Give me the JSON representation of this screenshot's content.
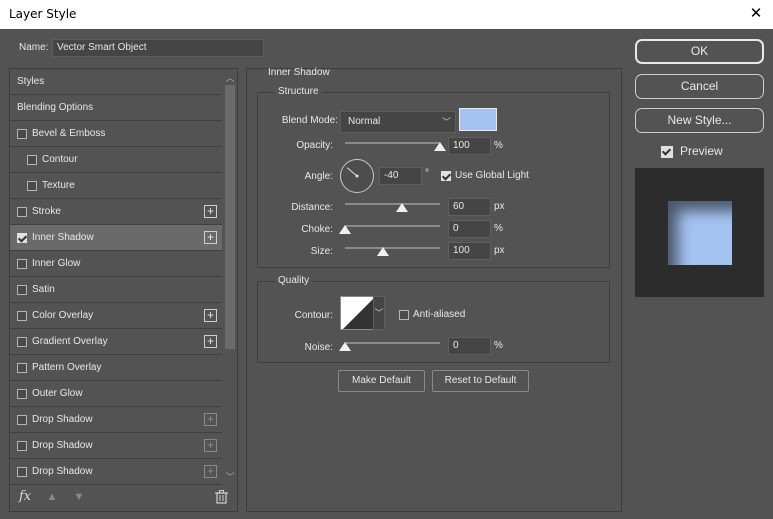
{
  "window": {
    "title": "Layer Style",
    "close_glyph": "✕"
  },
  "name": {
    "label": "Name:",
    "value": "Vector Smart Object"
  },
  "styles_list": [
    {
      "label": "Styles",
      "checkbox": false,
      "checked": false,
      "indent": false,
      "plus": "none",
      "active": false
    },
    {
      "label": "Blending Options",
      "checkbox": false,
      "checked": false,
      "indent": false,
      "plus": "none",
      "active": false
    },
    {
      "label": "Bevel & Emboss",
      "checkbox": true,
      "checked": false,
      "indent": false,
      "plus": "none",
      "active": false
    },
    {
      "label": "Contour",
      "checkbox": true,
      "checked": false,
      "indent": true,
      "plus": "none",
      "active": false
    },
    {
      "label": "Texture",
      "checkbox": true,
      "checked": false,
      "indent": true,
      "plus": "none",
      "active": false
    },
    {
      "label": "Stroke",
      "checkbox": true,
      "checked": false,
      "indent": false,
      "plus": "bright",
      "active": false
    },
    {
      "label": "Inner Shadow",
      "checkbox": true,
      "checked": true,
      "indent": false,
      "plus": "bright",
      "active": true
    },
    {
      "label": "Inner Glow",
      "checkbox": true,
      "checked": false,
      "indent": false,
      "plus": "none",
      "active": false
    },
    {
      "label": "Satin",
      "checkbox": true,
      "checked": false,
      "indent": false,
      "plus": "none",
      "active": false
    },
    {
      "label": "Color Overlay",
      "checkbox": true,
      "checked": false,
      "indent": false,
      "plus": "bright",
      "active": false
    },
    {
      "label": "Gradient Overlay",
      "checkbox": true,
      "checked": false,
      "indent": false,
      "plus": "bright",
      "active": false
    },
    {
      "label": "Pattern Overlay",
      "checkbox": true,
      "checked": false,
      "indent": false,
      "plus": "none",
      "active": false
    },
    {
      "label": "Outer Glow",
      "checkbox": true,
      "checked": false,
      "indent": false,
      "plus": "none",
      "active": false
    },
    {
      "label": "Drop Shadow",
      "checkbox": true,
      "checked": false,
      "indent": false,
      "plus": "dim",
      "active": false
    },
    {
      "label": "Drop Shadow",
      "checkbox": true,
      "checked": false,
      "indent": false,
      "plus": "dim",
      "active": false
    },
    {
      "label": "Drop Shadow",
      "checkbox": true,
      "checked": false,
      "indent": false,
      "plus": "dim",
      "active": false
    }
  ],
  "list_footer": {
    "fx": "fx",
    "icons": [
      "fx-icon",
      "move-up-icon",
      "move-down-icon",
      "trash-icon"
    ]
  },
  "inner_shadow": {
    "section_title": "Inner Shadow",
    "structure_title": "Structure",
    "blend_mode": {
      "label": "Blend Mode:",
      "value": "Normal",
      "color": "#a5c3f1"
    },
    "opacity": {
      "label": "Opacity:",
      "value": "100",
      "unit": "%",
      "level": 1.0
    },
    "angle": {
      "label": "Angle:",
      "value": "-40",
      "unit": "°",
      "use_global_light": "Use Global Light",
      "global_checked": true
    },
    "distance": {
      "label": "Distance:",
      "value": "60",
      "unit": "px",
      "level": 0.6
    },
    "choke": {
      "label": "Choke:",
      "value": "0",
      "unit": "%",
      "level": 0.0
    },
    "size": {
      "label": "Size:",
      "value": "100",
      "unit": "px",
      "level": 0.4
    },
    "quality_title": "Quality",
    "contour": {
      "label": "Contour:",
      "anti_aliased": "Anti-aliased",
      "anti_aliased_checked": false
    },
    "noise": {
      "label": "Noise:",
      "value": "0",
      "unit": "%",
      "level": 0.0
    },
    "make_default": "Make Default",
    "reset_default": "Reset to Default"
  },
  "buttons": {
    "ok": "OK",
    "cancel": "Cancel",
    "new_style": "New Style..."
  },
  "preview": {
    "label": "Preview",
    "checked": true
  }
}
